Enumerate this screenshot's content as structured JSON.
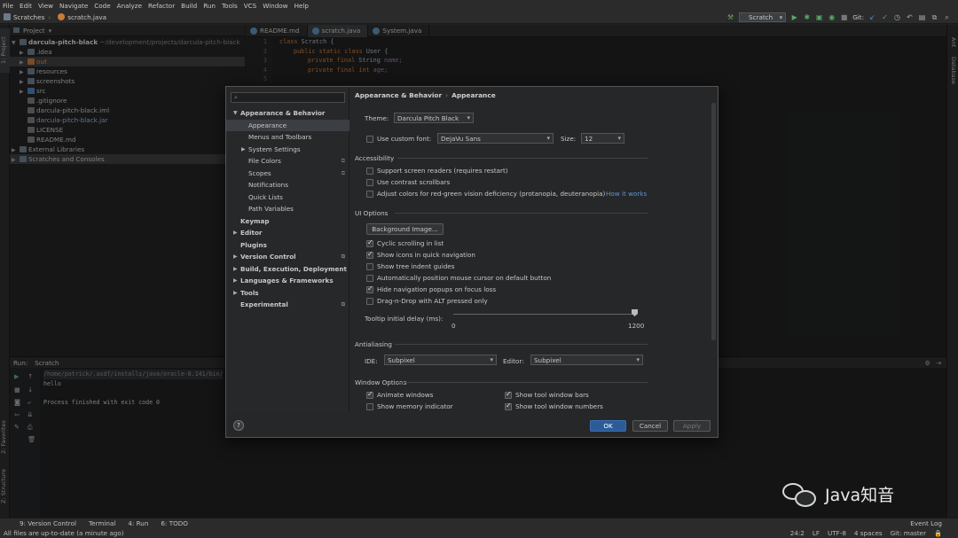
{
  "menu": [
    "File",
    "Edit",
    "View",
    "Navigate",
    "Code",
    "Analyze",
    "Refactor",
    "Build",
    "Run",
    "Tools",
    "VCS",
    "Window",
    "Help"
  ],
  "navbar": {
    "crumbs": [
      "Scratches",
      "scratch.java"
    ],
    "run_config": "Scratch",
    "git_label": "Git:"
  },
  "left_strip": {
    "project": "1: Project",
    "favorites": "2: Favorites",
    "structure": "Z: Structure"
  },
  "right_strip": {
    "ant": "Ant",
    "database": "Database"
  },
  "project": {
    "header": "Project",
    "items": [
      {
        "name": "darcula-pitch-black",
        "path": "~/development/projects/darcula-pitch-black"
      },
      {
        "name": ".idea"
      },
      {
        "name": "out"
      },
      {
        "name": "resources"
      },
      {
        "name": "screenshots"
      },
      {
        "name": "src"
      },
      {
        "name": ".gitignore"
      },
      {
        "name": "darcula-pitch-black.iml"
      },
      {
        "name": "darcula-pitch-black.jar"
      },
      {
        "name": "LICENSE"
      },
      {
        "name": "README.md"
      },
      {
        "name": "External Libraries"
      },
      {
        "name": "Scratches and Consoles"
      }
    ]
  },
  "editor": {
    "tabs": [
      "README.md",
      "scratch.java",
      "System.java"
    ],
    "line_numbers": [
      "1",
      "2",
      "3",
      "4",
      "5"
    ],
    "code": {
      "l1_kw": "class",
      "l1_rest": " Scratch {",
      "l2_kw": "public static class",
      "l2_rest": " User {",
      "l3_kw": "private final",
      "l3_type": " String",
      "l3_field": " name;",
      "l4_kw": "private final",
      "l4_type": " int",
      "l4_field": " age;"
    }
  },
  "run": {
    "header_label": "Run:",
    "header_tab": "Scratch",
    "output": [
      "/home/patrick/.asdf/installs/java/oracle-8.141/bin/",
      "hello",
      "",
      "Process finished with exit code 0"
    ]
  },
  "bottom_tabs": [
    "9: Version Control",
    "Terminal",
    "4: Run",
    "6: TODO"
  ],
  "event_log": "Event Log",
  "status": {
    "left": "All files are up-to-date (a minute ago)",
    "position": "24:2",
    "line_sep": "LF",
    "encoding": "UTF-8",
    "indent": "4 spaces",
    "branch": "Git: master"
  },
  "dialog": {
    "search_placeholder": "",
    "nav": [
      {
        "label": "Appearance & Behavior"
      },
      {
        "label": "Appearance"
      },
      {
        "label": "Menus and Toolbars"
      },
      {
        "label": "System Settings"
      },
      {
        "label": "File Colors"
      },
      {
        "label": "Scopes"
      },
      {
        "label": "Notifications"
      },
      {
        "label": "Quick Lists"
      },
      {
        "label": "Path Variables"
      },
      {
        "label": "Keymap"
      },
      {
        "label": "Editor"
      },
      {
        "label": "Plugins"
      },
      {
        "label": "Version Control"
      },
      {
        "label": "Build, Execution, Deployment"
      },
      {
        "label": "Languages & Frameworks"
      },
      {
        "label": "Tools"
      },
      {
        "label": "Experimental"
      }
    ],
    "breadcrumb": {
      "parent": "Appearance & Behavior",
      "sep": "›",
      "current": "Appearance"
    },
    "theme_label": "Theme:",
    "theme_value": "Darcula Pitch Black",
    "custom_font_label": "Use custom font:",
    "custom_font_checked": false,
    "font_value": "DejaVu Sans",
    "size_label": "Size:",
    "size_value": "12",
    "accessibility": {
      "title": "Accessibility",
      "options": [
        {
          "label": "Support screen readers (requires restart)",
          "checked": false
        },
        {
          "label": "Use contrast scrollbars",
          "checked": false
        },
        {
          "label": "Adjust colors for red-green vision deficiency (protanopia, deuteranopia)",
          "checked": false
        }
      ],
      "link": "How it works"
    },
    "ui_options": {
      "title": "UI Options",
      "bg_button": "Background Image...",
      "options": [
        {
          "label": "Cyclic scrolling in list",
          "checked": true
        },
        {
          "label": "Show icons in quick navigation",
          "checked": true
        },
        {
          "label": "Show tree indent guides",
          "checked": false
        },
        {
          "label": "Automatically position mouse cursor on default button",
          "checked": false
        },
        {
          "label": "Hide navigation popups on focus loss",
          "checked": true
        },
        {
          "label": "Drag-n-Drop with ALT pressed only",
          "checked": false
        }
      ],
      "tooltip_label": "Tooltip initial delay (ms):",
      "slider_min": "0",
      "slider_max": "1200",
      "slider_value": 1200
    },
    "antialiasing": {
      "title": "Antialiasing",
      "ide_label": "IDE:",
      "ide_value": "Subpixel",
      "editor_label": "Editor:",
      "editor_value": "Subpixel"
    },
    "window_options": {
      "title": "Window Options",
      "options": [
        {
          "label": "Animate windows",
          "checked": true
        },
        {
          "label": "Show tool window bars",
          "checked": true
        },
        {
          "label": "Show memory indicator",
          "checked": false
        },
        {
          "label": "Show tool window numbers",
          "checked": true
        }
      ]
    },
    "buttons": {
      "help": "?",
      "ok": "OK",
      "cancel": "Cancel",
      "apply": "Apply"
    }
  },
  "watermark": {
    "text": "Java知音"
  },
  "colors": {
    "accent": "#2c5c97",
    "link": "#5e94d6",
    "keyword": "#cc7832",
    "field": "#9876aa"
  }
}
